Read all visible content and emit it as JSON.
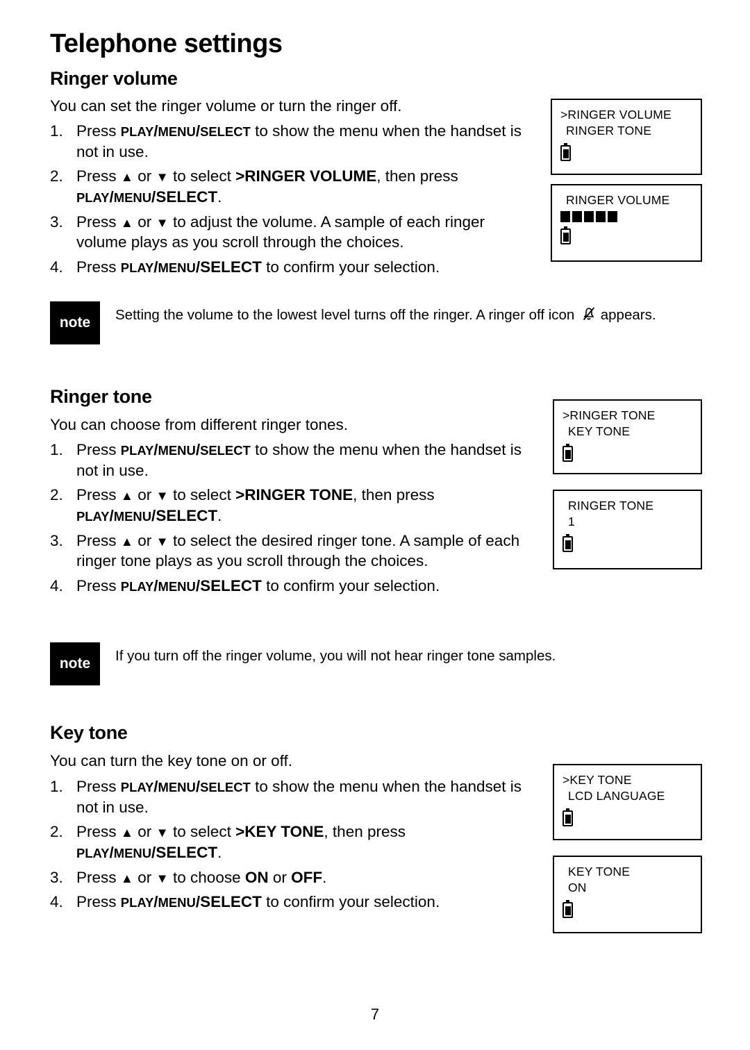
{
  "page": {
    "title": "Telephone settings",
    "number": "7"
  },
  "sections": [
    {
      "id": "ringer-volume",
      "heading": "Ringer volume",
      "intro": "You can set the ringer volume or turn the ringer off.",
      "steps": [
        {
          "num": "1.",
          "parts": [
            "Press ",
            "PLAY",
            "/",
            "MENU",
            "/",
            "SELECT",
            " to show the menu when the handset is not in use."
          ]
        },
        {
          "num": "2.",
          "text": "Press ▲ or ▼ to select >RINGER VOLUME, then press PLAY/MENU/SELECT."
        },
        {
          "num": "3.",
          "text": "Press ▲ or ▼ to adjust the volume. A sample of each ringer volume plays as you scroll through the choices."
        },
        {
          "num": "4.",
          "text": "Press PLAY/MENU/SELECT to confirm your selection."
        }
      ],
      "note": {
        "badge": "note",
        "text": "Setting the volume to the lowest level turns off the ringer. A ringer off icon    appears."
      },
      "screens": [
        {
          "lines": [
            ">RINGER VOLUME",
            "RINGER TONE"
          ],
          "bars": 0
        },
        {
          "lines": [
            "RINGER VOLUME"
          ],
          "bars": 5
        }
      ]
    },
    {
      "id": "ringer-tone",
      "heading": "Ringer tone",
      "intro": "You can choose from different ringer tones.",
      "steps": [
        {
          "num": "1."
        },
        {
          "num": "2."
        },
        {
          "num": "3."
        },
        {
          "num": "4."
        }
      ],
      "note": {
        "badge": "note",
        "text": "If you turn off the ringer volume, you will not hear ringer tone samples."
      },
      "screens": [
        {
          "lines": [
            ">RINGER TONE",
            "KEY TONE"
          ]
        },
        {
          "lines": [
            "RINGER TONE",
            "1"
          ]
        }
      ]
    },
    {
      "id": "key-tone",
      "heading": "Key tone",
      "intro": "You can turn the key tone on or off.",
      "screens": [
        {
          "lines": [
            ">KEY TONE",
            "LCD LANGUAGE"
          ]
        },
        {
          "lines": [
            "KEY TONE",
            "ON"
          ]
        }
      ]
    }
  ],
  "text": {
    "rv_step1_a": "Press ",
    "rv_step1_play": "PLAY",
    "rv_step1_slash1": "/",
    "rv_step1_menu": "MENU",
    "rv_step1_slash2": "/",
    "rv_step1_select": "SELECT",
    "rv_step1_b": " to show the menu when the handset is not in use.",
    "rv_step2_a": "Press ",
    "rv_step2_b": " or ",
    "rv_step2_c": " to select ",
    "rv_step2_menuitem": ">RINGER VOLUME",
    "rv_step2_d": ", then press ",
    "rv_step2_play": "PLAY",
    "rv_step2_menu": "MENU",
    "rv_step2_select": "SELECT",
    "rv_step2_period": ".",
    "rv_step3_a": "Press ",
    "rv_step3_b": " or ",
    "rv_step3_c": " to adjust the volume. A sample of each ringer volume plays as you scroll through the choices.",
    "rv_step4_a": "Press ",
    "rv_step4_play": "PLAY",
    "rv_step4_menu": "MENU",
    "rv_step4_select": "SELECT",
    "rv_step4_b": " to confirm your selection.",
    "rt_step1_a": "Press ",
    "rt_step1_play": "PLAY",
    "rt_step1_menu": "MENU",
    "rt_step1_select": "SELECT",
    "rt_step1_b": " to show the menu when the handset is not in use.",
    "rt_step2_a": "Press ",
    "rt_step2_b": " or ",
    "rt_step2_c": " to select ",
    "rt_step2_menuitem": ">RINGER TONE",
    "rt_step2_d": ", then press ",
    "rt_step2_play": "PLAY",
    "rt_step2_menu": "MENU",
    "rt_step2_select": "SELECT",
    "rt_step2_period": ".",
    "rt_step3_a": "Press ",
    "rt_step3_b": " or ",
    "rt_step3_c": " to select the desired ringer tone. A sample of each ringer tone plays as you scroll through the choices.",
    "rt_step4_a": "Press ",
    "rt_step4_play": "PLAY",
    "rt_step4_menu": "MENU",
    "rt_step4_select": "SELECT",
    "rt_step4_b": " to confirm your selection.",
    "kt_step1_a": "Press ",
    "kt_step1_play": "PLAY",
    "kt_step1_menu": "MENU",
    "kt_step1_select": "SELECT",
    "kt_step1_b": " to show the menu when the handset is not in use.",
    "kt_step2_a": "Press ",
    "kt_step2_b": " or ",
    "kt_step2_c": " to select ",
    "kt_step2_menuitem": ">KEY TONE",
    "kt_step2_d": ", then press ",
    "kt_step2_play": "PLAY",
    "kt_step2_menu": "MENU",
    "kt_step2_select": "SELECT",
    "kt_step2_period": ".",
    "kt_step3_a": "Press ",
    "kt_step3_b": " or ",
    "kt_step3_c": " to choose ",
    "kt_step3_on": "ON",
    "kt_step3_or": " or ",
    "kt_step3_off": "OFF",
    "kt_step3_period": ".",
    "kt_step4_a": "Press ",
    "kt_step4_play": "PLAY",
    "kt_step4_menu": "MENU",
    "kt_step4_select": "SELECT",
    "kt_step4_b": " to confirm your selection.",
    "note1_pre": "Setting the volume to the lowest level turns off the ringer. A ringer off icon",
    "note1_post": "appears.",
    "note2": "If you turn off the ringer volume, you will not hear ringer tone samples.",
    "note_badge": "note",
    "lcd1_l1": ">RINGER VOLUME",
    "lcd1_l2": "RINGER TONE",
    "lcd2_l1": "RINGER VOLUME",
    "lcd3_l1": ">RINGER TONE",
    "lcd3_l2": "KEY TONE",
    "lcd4_l1": "RINGER TONE",
    "lcd4_l2": "1",
    "lcd5_l1": ">KEY TONE",
    "lcd5_l2": "LCD LANGUAGE",
    "lcd6_l1": "KEY TONE",
    "lcd6_l2": "ON",
    "num1": "1.",
    "num2": "2.",
    "num3": "3.",
    "num4": "4."
  }
}
